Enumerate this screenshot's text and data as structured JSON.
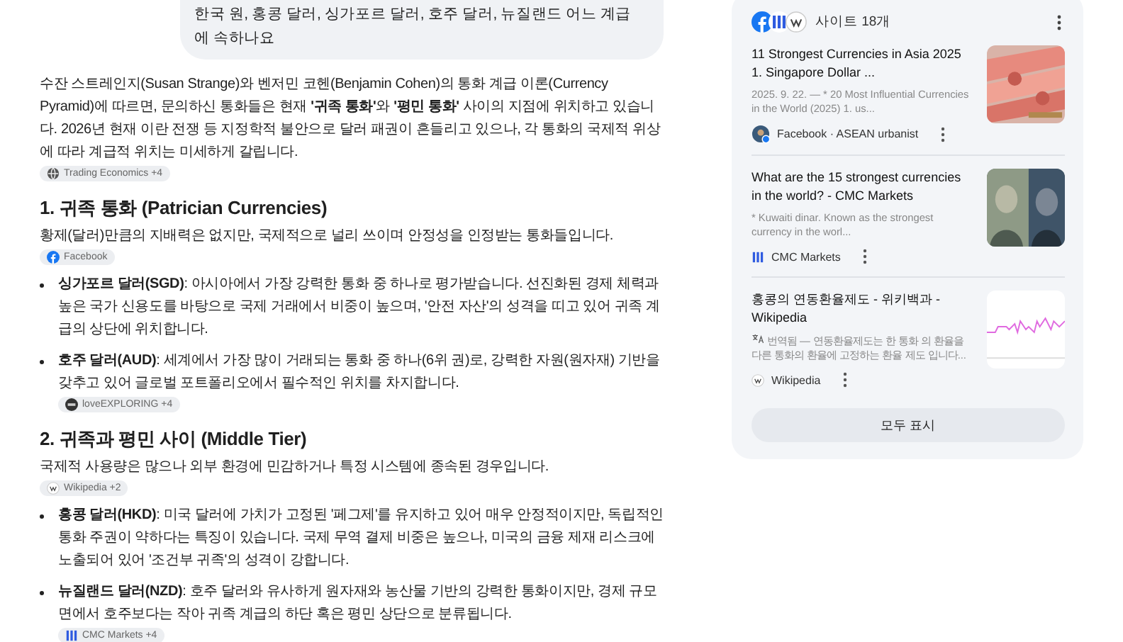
{
  "query": "한국 원, 홍콩 달러, 싱가포르 달러, 호주 달러, 뉴질랜드 어느 계급에 속하나요",
  "answer": [
    {
      "kind": "paragraph",
      "text": "수잔 스트레인지(Susan Strange)와 벤저민 코헨(Benjamin Cohen)의 통화 계급 이론(Currency Pyramid)에 따르면, 문의하신 통화들은 현재 **'귀족 통화'**와 **'평민 통화'** 사이의 지점에 위치하고 있습니다. 2026년 현재 이란 전쟁 등 지정학적 불안으로 달러 패권이 흔들리고 있으나, 각 통화의 국제적 위상에 따라 계급적 위치는 미세하게 갈립니다.",
      "source": {
        "kind": "globe",
        "label": "Trading Economics +4"
      }
    },
    {
      "kind": "heading",
      "text": "1. 귀족 통화 (Patrician Currencies)"
    },
    {
      "kind": "paragraph",
      "text": "황제(달러)만큼의 지배력은 없지만, 국제적으로 널리 쓰이며 안정성을 인정받는 통화들입니다.",
      "source": {
        "kind": "facebook",
        "label": "Facebook"
      }
    },
    {
      "kind": "bullet",
      "text": "**싱가포르 달러(SGD)**: 아시아에서 가장 강력한 통화 중 하나로 평가받습니다. 선진화된 경제 체력과 높은 국가 신용도를 바탕으로 국제 거래에서 비중이 높으며, '안전 자산'의 성격을 띠고 있어 귀족 계급의 상단에 위치합니다."
    },
    {
      "kind": "bullet",
      "text": "**호주 달러(AUD)**: 세계에서 가장 많이 거래되는 통화 중 하나(6위 권)로, 강력한 자원(원자재) 기반을 갖추고 있어 글로벌 포트폴리오에서 필수적인 위치를 차지합니다.",
      "source": {
        "kind": "dark",
        "label": "loveEXPLORING +4"
      }
    },
    {
      "kind": "heading",
      "text": "2. 귀족과 평민 사이 (Middle Tier)"
    },
    {
      "kind": "paragraph",
      "text": "국제적 사용량은 많으나 외부 환경에 민감하거나 특정 시스템에 종속된 경우입니다.",
      "source": {
        "kind": "wiki",
        "label": "Wikipedia +2"
      }
    },
    {
      "kind": "bullet",
      "text": "**홍콩 달러(HKD)**: 미국 달러에 가치가 고정된 '페그제'를 유지하고 있어 매우 안정적이지만, 독립적인 통화 주권이 약하다는 특징이 있습니다. 국제 무역 결제 비중은 높으나, 미국의 금융 제재 리스크에 노출되어 있어 '조건부 귀족'의 성격이 강합니다."
    },
    {
      "kind": "bullet",
      "text": "**뉴질랜드 달러(NZD)**: 호주 달러와 유사하게 원자재와 농산물 기반의 강력한 통화이지만, 경제 규모 면에서 호주보다는 작아 귀족 계급의 하단 혹은 평민 상단으로 분류됩니다.",
      "source": {
        "kind": "cmc",
        "label": "CMC Markets +4"
      }
    }
  ],
  "sources": {
    "count": "사이트 18개",
    "cards": [
      {
        "title": "11 Strongest Currencies in Asia 2025 1. Singapore Dollar ...",
        "snippet": "2025. 9. 22. — * 20 Most Influential Currencies in the World (2025) 1. us...",
        "site": "Facebook · ASEAN urbanist"
      },
      {
        "title": "What are the 15 strongest currencies in the world? - CMC Markets",
        "snippet": "* Kuwaiti dinar. Known as the strongest currency in the worl...",
        "site": "CMC Markets"
      },
      {
        "title": "홍콩의 연동환율제도 - 위키백과 - Wikipedia",
        "snippet": "번역됨 — 연동환율제도는 한 통화 의 환율을 다른 통화의 환율에 고정하는 환율 제도 입니다...",
        "site": "Wikipedia"
      }
    ],
    "show_all": "모두 표시"
  }
}
